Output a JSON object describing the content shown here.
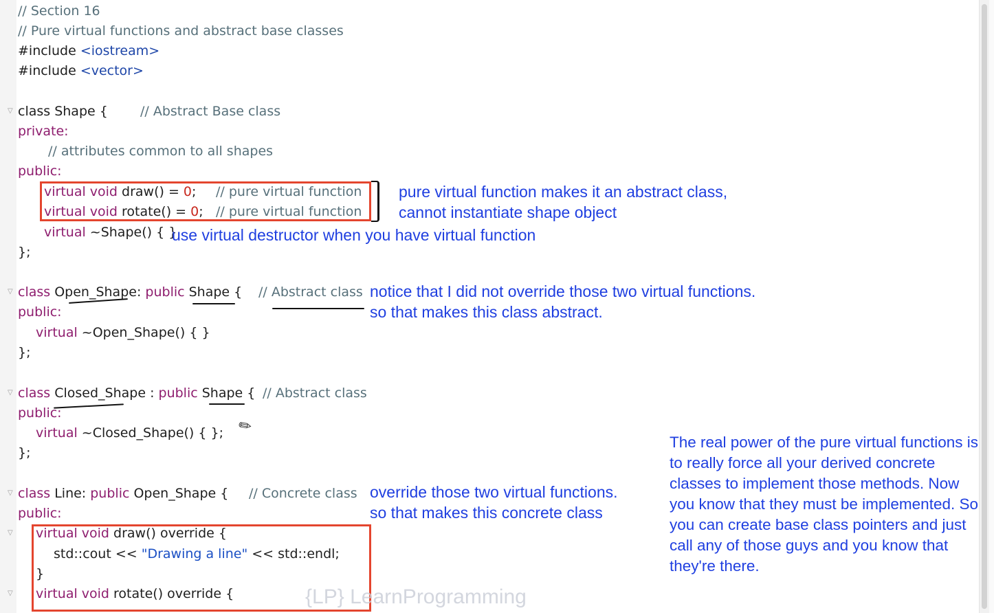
{
  "code": {
    "l1": "// Section 16",
    "l2": "// Pure virtual functions and abstract base classes",
    "l3_directive": "#include",
    "l3_header": "<iostream>",
    "l4_directive": "#include",
    "l4_header": "<vector>",
    "shape_class_decl": "class Shape {",
    "shape_class_comment": "// Abstract Base class",
    "shape_private": "private:",
    "shape_attrs_comment": "// attributes common to all shapes",
    "shape_public": "public:",
    "draw_decl_kw": "virtual void",
    "draw_decl_rest": " draw() = ",
    "draw_zero": "0",
    "draw_semi": ";",
    "draw_comment": "// pure virtual function",
    "rotate_decl_kw": "virtual void",
    "rotate_decl_rest": " rotate() = ",
    "rotate_zero": "0",
    "rotate_semi": ";",
    "rotate_comment": "// pure virtual function",
    "shape_dtor_kw": "virtual",
    "shape_dtor_rest": " ~Shape() { }",
    "shape_close": "};",
    "open_class_kw": "class",
    "open_class_rest": " Open_Shape: ",
    "open_class_kw2": "public",
    "open_class_base": " Shape {",
    "open_class_comment": "// Abstract class",
    "open_public": "public:",
    "open_dtor_kw": "virtual",
    "open_dtor_rest": " ~Open_Shape() { }",
    "open_close": "};",
    "closed_class_kw": "class",
    "closed_class_rest": " Closed_Shape : ",
    "closed_class_kw2": "public",
    "closed_class_base": " Shape {",
    "closed_class_comment": "// Abstract class",
    "closed_public": "public:",
    "closed_dtor_kw": "virtual",
    "closed_dtor_rest": " ~Closed_Shape() { };",
    "closed_close": "};",
    "line_class_kw": "class",
    "line_class_rest": " Line: ",
    "line_class_kw2": "public",
    "line_class_base": " Open_Shape {",
    "line_class_comment": "// Concrete class",
    "line_public": "public:",
    "line_draw_kw": "virtual void",
    "line_draw_rest": " draw() override {",
    "line_cout_pre": "std::cout << ",
    "line_cout_str": "\"Drawing a line\"",
    "line_cout_post": " << std::endl;",
    "line_draw_close": "}",
    "line_rotate_kw": "virtual void",
    "line_rotate_rest": " rotate() override {"
  },
  "annotations": {
    "pure_virtual_line1": "pure virtual function makes it an abstract class,",
    "pure_virtual_line2": "cannot instantiate shape object",
    "virtual_destructor": "use virtual destructor when you have virtual function",
    "open_shape_line1": "notice that I did not override those two virtual functions.",
    "open_shape_line2": "so that makes this class abstract.",
    "line_class_line1": "override those two virtual functions.",
    "line_class_line2": "so that makes this concrete class",
    "power_note": "The real power of the pure virtual functions is to really force all your derived concrete classes to implement those methods. Now you know that they must be implemented. So you can create base class pointers and just call any of those guys and you know that they're there."
  },
  "watermark": {
    "brand_mark": "{LP}",
    "brand_name": "LearnProgramming"
  },
  "colors": {
    "annotation": "#1f3fe0",
    "highlight_box": "#e4452e",
    "keyword": "#8e1d6e",
    "comment": "#57707a",
    "string": "#1a4fc4",
    "number": "#c8281e"
  },
  "icons": {
    "cursor": "pencil-cursor-icon",
    "fold": "fold-marker-icon"
  }
}
